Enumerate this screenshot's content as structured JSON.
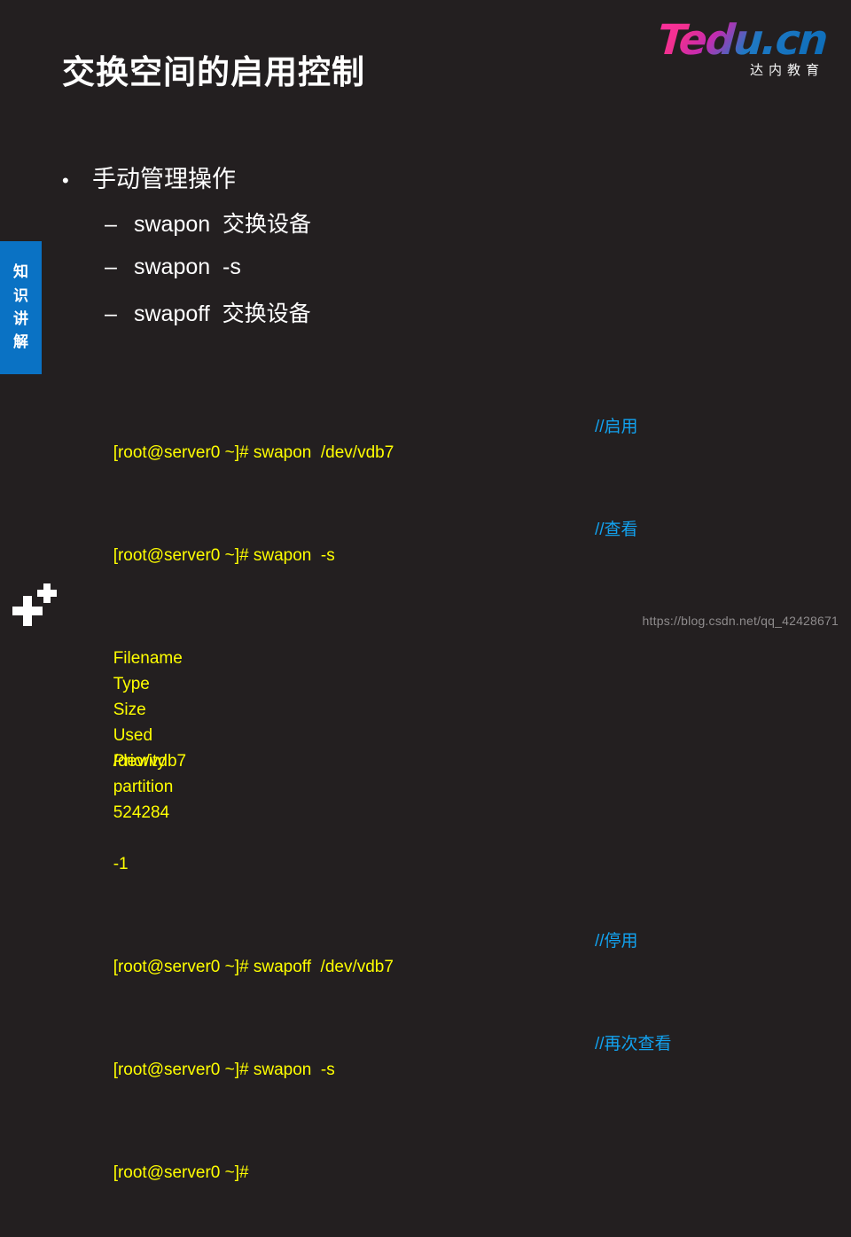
{
  "slide": {
    "background_color": "#231f20",
    "title": "交换空间的启用控制"
  },
  "logo": {
    "wordmark": "Tedu.cn",
    "subtitle": "达内教育",
    "gradient_from": "#ff2f9e",
    "gradient_to": "#0b6cb8"
  },
  "side_tab": {
    "color": "#0a72c4",
    "chars": [
      "知",
      "识",
      "讲",
      "解"
    ]
  },
  "bullets": {
    "level1": {
      "marker": "•",
      "text": "手动管理操作"
    },
    "level2": [
      {
        "marker": "–",
        "text": "swapon  交换设备"
      },
      {
        "marker": "–",
        "text": "swapon  -s"
      },
      {
        "marker": "–",
        "text": "swapoff  交换设备"
      }
    ]
  },
  "terminal": {
    "cmd_color": "#ffff00",
    "note_color": "#12a2ef",
    "lines": [
      {
        "type": "cmd",
        "text": "[root@server0 ~]# swapon  /dev/vdb7",
        "note": "//启用"
      },
      {
        "type": "cmd",
        "text": "[root@server0 ~]# swapon  -s",
        "note": "//查看"
      },
      {
        "type": "table",
        "cells": [
          "Filename",
          "Type",
          "Size",
          "Used",
          "Priority"
        ]
      },
      {
        "type": "table",
        "cells": [
          "/dev/vdb7",
          "partition",
          "524284",
          "",
          "-1"
        ]
      },
      {
        "type": "blank"
      },
      {
        "type": "cmd",
        "text": "[root@server0 ~]# swapoff  /dev/vdb7",
        "note": "//停用"
      },
      {
        "type": "cmd",
        "text": "[root@server0 ~]# swapon  -s",
        "note": "//再次查看"
      },
      {
        "type": "cmd",
        "text": "[root@server0 ~]#",
        "note": ""
      }
    ]
  },
  "watermark": "https://blog.csdn.net/qq_42428671"
}
